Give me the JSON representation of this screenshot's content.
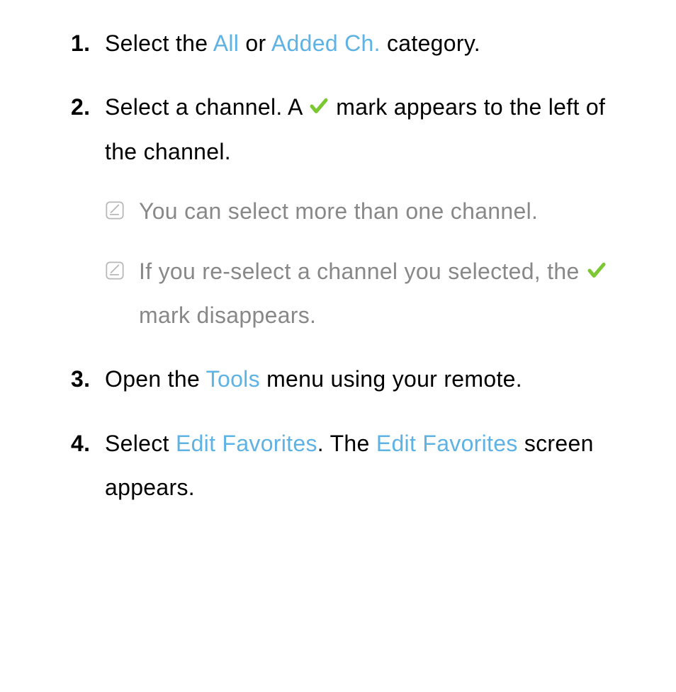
{
  "items": [
    {
      "number": "1.",
      "segments": [
        {
          "text": "Select the "
        },
        {
          "text": "All",
          "highlight": true
        },
        {
          "text": " or "
        },
        {
          "text": "Added Ch.",
          "highlight": true
        },
        {
          "text": " category."
        }
      ]
    },
    {
      "number": "2.",
      "segments": [
        {
          "text": "Select a channel. A "
        },
        {
          "icon": "check"
        },
        {
          "text": " mark appears to the left of the channel."
        }
      ],
      "notes": [
        {
          "segments": [
            {
              "text": "You can select more than one channel."
            }
          ]
        },
        {
          "segments": [
            {
              "text": "If you re-select a channel you selected, the "
            },
            {
              "icon": "check"
            },
            {
              "text": " mark disappears."
            }
          ]
        }
      ]
    },
    {
      "number": "3.",
      "segments": [
        {
          "text": "Open the "
        },
        {
          "text": "Tools",
          "highlight": true
        },
        {
          "text": " menu using your remote."
        }
      ]
    },
    {
      "number": "4.",
      "segments": [
        {
          "text": "Select "
        },
        {
          "text": "Edit Favorites",
          "highlight": true
        },
        {
          "text": ". The "
        },
        {
          "text": "Edit Favorites",
          "highlight": true
        },
        {
          "text": " screen appears."
        }
      ]
    }
  ]
}
